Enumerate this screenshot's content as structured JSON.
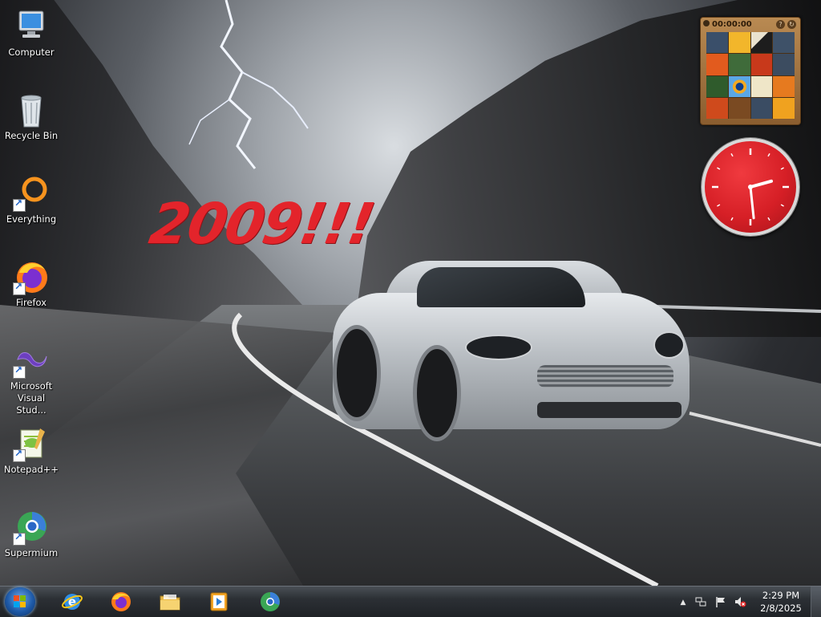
{
  "desktop": {
    "icons": [
      {
        "label": "Computer",
        "icon": "computer-icon"
      },
      {
        "label": "Recycle Bin",
        "icon": "recycle-bin-icon"
      },
      {
        "label": "Everything",
        "icon": "everything-search-icon"
      },
      {
        "label": "Firefox",
        "icon": "firefox-icon"
      },
      {
        "label": "Microsoft Visual Stud...",
        "icon": "visual-studio-icon"
      },
      {
        "label": "Notepad++",
        "icon": "notepad-plus-plus-icon"
      },
      {
        "label": "Supermium",
        "icon": "supermium-icon"
      }
    ],
    "wallpaper_text": "2009!!!"
  },
  "gadgets": {
    "puzzle": {
      "timer": "00:00:00",
      "help_label": "?",
      "shuffle_label": "↻"
    },
    "clock": {
      "hour": 2,
      "minute": 29,
      "face_color": "#d61f26"
    }
  },
  "taskbar": {
    "pinned": [
      {
        "name": "internet-explorer",
        "icon": "internet-explorer-icon"
      },
      {
        "name": "firefox",
        "icon": "firefox-icon"
      },
      {
        "name": "file-explorer",
        "icon": "folder-icon"
      },
      {
        "name": "media-player",
        "icon": "media-player-icon"
      },
      {
        "name": "supermium",
        "icon": "supermium-icon"
      }
    ],
    "tray": {
      "overflow": "▲",
      "time": "2:29 PM",
      "date": "2/8/2025"
    }
  }
}
